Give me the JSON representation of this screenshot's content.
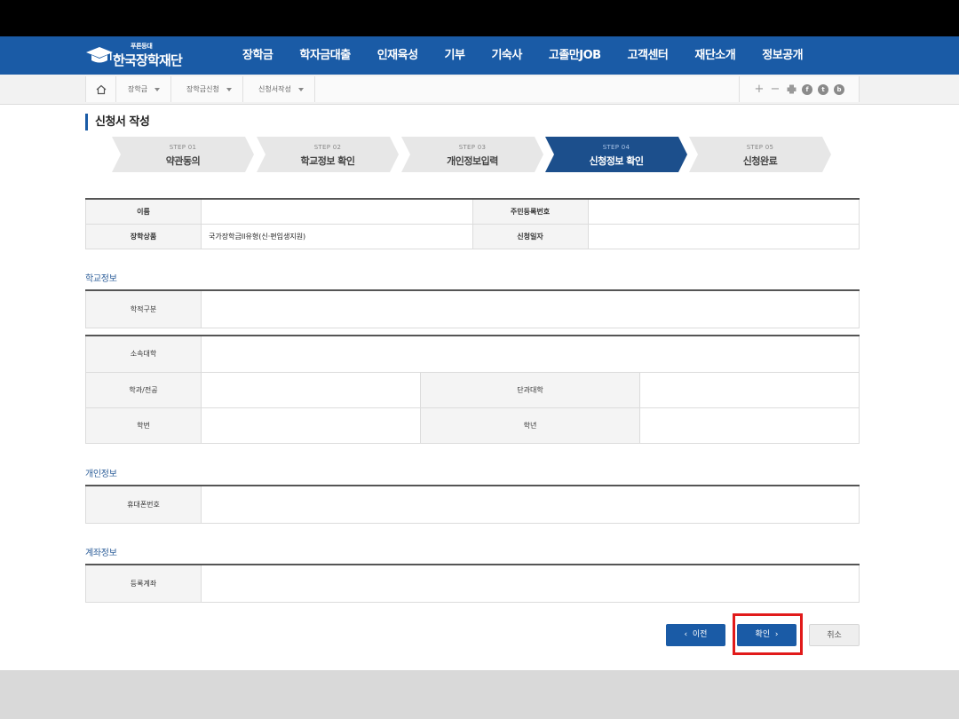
{
  "header": {
    "logo_small": "푸른등대",
    "logo_name": "한국장학재단",
    "menu": [
      "장학금",
      "학자금대출",
      "인재육성",
      "기부",
      "기숙사",
      "고졸만JOB",
      "고객센터",
      "재단소개",
      "정보공개"
    ]
  },
  "breadcrumb": [
    "장학금",
    "장학금신청",
    "신청서작성"
  ],
  "page_title": "신청서 작성",
  "steps": [
    {
      "num": "STEP 01",
      "label": "약관동의"
    },
    {
      "num": "STEP 02",
      "label": "학교정보 확인"
    },
    {
      "num": "STEP 03",
      "label": "개인정보입력"
    },
    {
      "num": "STEP 04",
      "label": "신청정보 확인"
    },
    {
      "num": "STEP 05",
      "label": "신청완료"
    }
  ],
  "active_step": 4,
  "basic_info": {
    "name_label": "이름",
    "name_value": "",
    "rrn_label": "주민등록번호",
    "rrn_value": "",
    "product_label": "장학상품",
    "product_value": "국가장학금II유형(신·편입생지원)",
    "date_label": "신청일자",
    "date_value": ""
  },
  "school_section": {
    "title": "학교정보",
    "status_label": "학적구분",
    "univ_label": "소속대학",
    "major_label": "학과/전공",
    "college_label": "단과대학",
    "student_no_label": "학번",
    "grade_label": "학년"
  },
  "personal_section": {
    "title": "개인정보",
    "phone_label": "휴대폰번호"
  },
  "account_section": {
    "title": "계좌정보",
    "account_label": "등록계좌"
  },
  "buttons": {
    "prev": "이전",
    "confirm": "확인",
    "cancel": "취소"
  },
  "colors": {
    "brand_blue": "#1a5ba6",
    "active_step": "#1c4f8c",
    "highlight_red": "#e11a1a"
  }
}
